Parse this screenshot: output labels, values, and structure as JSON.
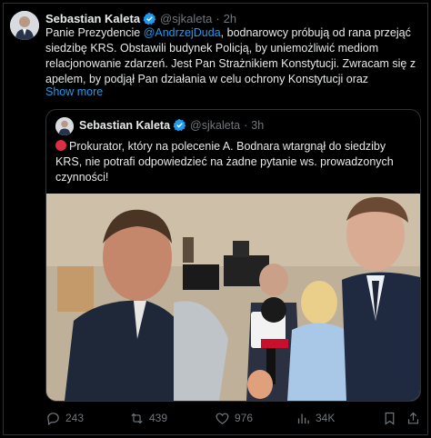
{
  "tweet": {
    "author_name": "Sebastian Kaleta",
    "handle": "@sjkaleta",
    "separator": "·",
    "time": "2h",
    "text_1": "Panie Prezydencie ",
    "mention": "@AndrzejDuda",
    "text_2": ", bodnarowcy próbują od rana przejąć siedzibę KRS. Obstawili budynek Policją, by uniemożliwić mediom relacjonowanie zdarzeń. Jest Pan Strażnikiem Konstytucji. Zwracam się z apelem, by podjął Pan działania w celu ochrony Konstytucji oraz",
    "show_more": "Show more"
  },
  "quote": {
    "author_name": "Sebastian Kaleta",
    "handle": "@sjkaleta",
    "separator": "·",
    "time": "3h",
    "text": "Prokurator, który na polecenie A. Bodnara wtargnął do siedziby KRS, nie potrafi odpowiedzieć na żadne pytanie ws. prowadzonych czynności!"
  },
  "actions": {
    "replies": "243",
    "reposts": "439",
    "likes": "976",
    "views": "34K"
  },
  "icons": {
    "verified": "verified-badge-icon",
    "reply": "reply-icon",
    "repost": "repost-icon",
    "like": "heart-icon",
    "views": "views-icon",
    "bookmark": "bookmark-icon",
    "share": "share-icon"
  },
  "colors": {
    "background": "#000000",
    "accent": "#1d9bf0",
    "muted": "#71767b",
    "text": "#e7e9ea",
    "border": "#2f3336"
  }
}
